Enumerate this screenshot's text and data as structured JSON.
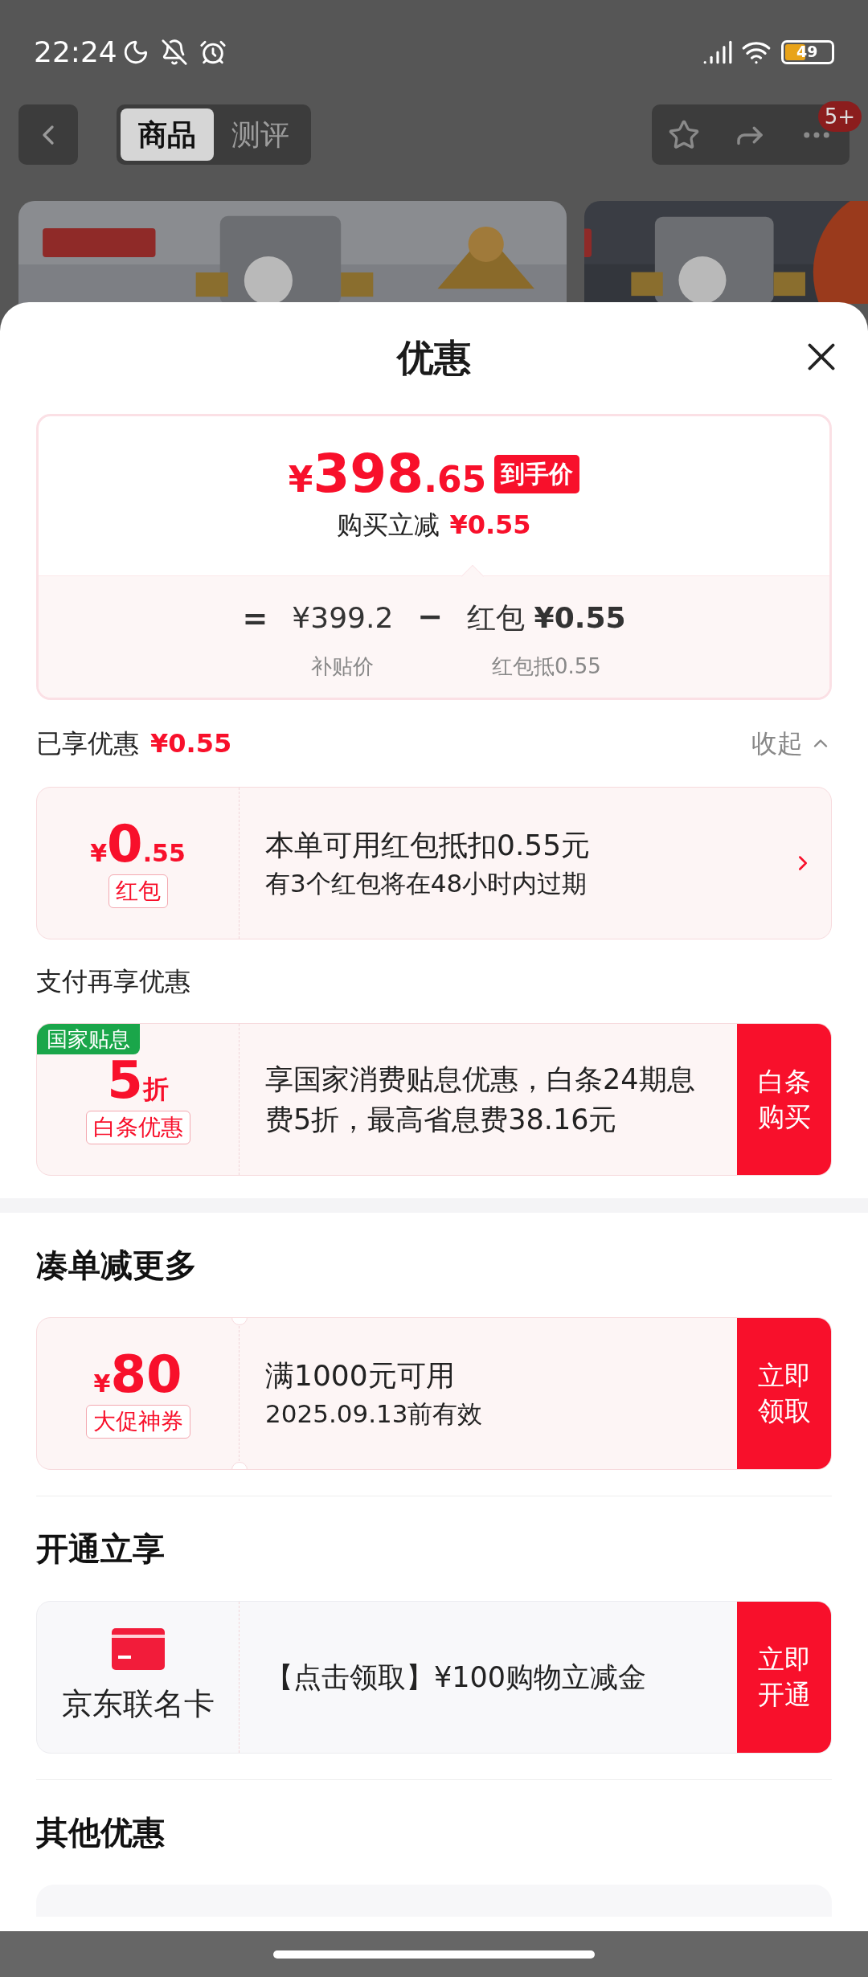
{
  "status_bar": {
    "time": "22:24",
    "battery": "49"
  },
  "nav": {
    "tabs": [
      {
        "label": "商品",
        "selected": true
      },
      {
        "label": "测评",
        "selected": false
      }
    ],
    "badge": "5+"
  },
  "sheet": {
    "title": "优惠"
  },
  "price_card": {
    "symbol": "¥",
    "price_int": "398",
    "price_dec": ".65",
    "tag": "到手价",
    "subtitle_label": "购买立减",
    "subtitle_amount": "¥0.55",
    "equals": "=",
    "base_price": "¥399.2",
    "minus": "−",
    "deduct_label": "红包",
    "deduct_amount": "¥0.55",
    "base_caption": "补贴价",
    "deduct_caption": "红包抵0.55"
  },
  "enjoyed": {
    "label": "已享优惠",
    "amount": "¥0.55",
    "toggle": "收起",
    "expanded": true
  },
  "sections": [
    {
      "kind": "plain",
      "cards": [
        {
          "kind": "amount",
          "symbol": "¥",
          "value": "0",
          "decimal": ".55",
          "tag": "红包",
          "line1": "本单可用红包抵扣0.55元",
          "line2": "有3个红包将在48小时内过期",
          "link": true
        }
      ]
    },
    {
      "kind": "sub",
      "heading": "支付再享优惠",
      "cards": [
        {
          "kind": "discount",
          "ribbon": "国家贴息",
          "value": "5",
          "unit": "折",
          "tag": "白条优惠",
          "text": "享国家消费贴息优惠，白条24期息费5折，最高省息费38.16元",
          "button": "白条购买"
        }
      ]
    },
    {
      "kind": "block",
      "heading": "凑单减更多",
      "cards": [
        {
          "kind": "amount",
          "notched": true,
          "symbol": "¥",
          "value": "80",
          "tag": "大促神券",
          "line1": "满1000元可用",
          "line2": "2025.09.13前有效",
          "button": "立即领取"
        }
      ]
    },
    {
      "kind": "main",
      "heading": "开通立享",
      "cards": [
        {
          "kind": "card",
          "name": "京东联名卡",
          "text": "【点击领取】¥100购物立减金",
          "button": "立即开通"
        }
      ]
    },
    {
      "kind": "main",
      "heading": "其他优惠",
      "cards": [
        {
          "kind": "partial"
        }
      ]
    }
  ]
}
